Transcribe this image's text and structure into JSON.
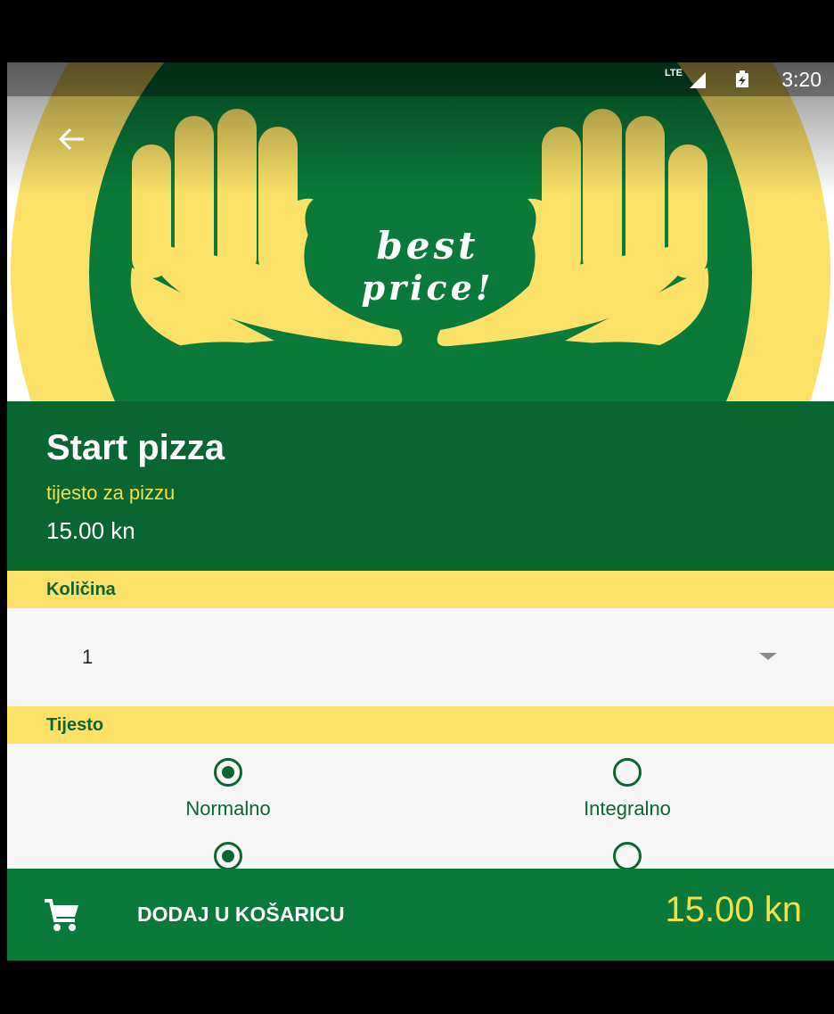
{
  "status_bar": {
    "network": "LTE",
    "time": "3:20"
  },
  "hero": {
    "image_text_line1": "best",
    "image_text_line2": "price!",
    "colors": {
      "yellow": "#fbe168",
      "green": "#0a7a3a"
    }
  },
  "product": {
    "title": "Start pizza",
    "subtitle": "tijesto za pizzu",
    "price": "15.00 kn"
  },
  "quantity": {
    "label": "Količina",
    "value": "1"
  },
  "dough": {
    "label": "Tijesto",
    "options": [
      {
        "label": "Normalno",
        "checked": true
      },
      {
        "label": "Integralno",
        "checked": false
      }
    ],
    "second_row": [
      {
        "checked": true
      },
      {
        "checked": false
      }
    ]
  },
  "cart": {
    "button_label": "DODAJ U KOŠARICU",
    "total": "15.00 kn"
  },
  "icons": {
    "back": "arrow-back-icon",
    "cart": "shopping-cart-icon",
    "dropdown": "dropdown-arrow-icon"
  }
}
